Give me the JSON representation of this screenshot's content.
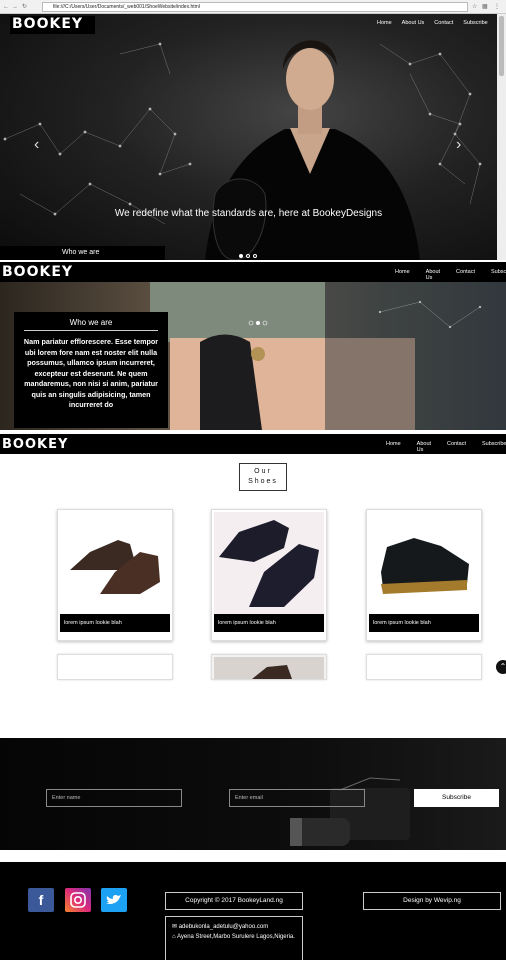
{
  "browser": {
    "url": "file:///C:/Users/User/Documents/_web001/ShoeWebsite/index.html",
    "back_icon": "back-arrow-icon",
    "forward_icon": "forward-arrow-icon",
    "reload_icon": "reload-icon"
  },
  "brand": {
    "logo_text": "BOOKEY"
  },
  "nav": {
    "items": [
      "Home",
      "About Us",
      "Contact",
      "Subscribe"
    ],
    "truncated_subscribe": "Subscr",
    "truncated_subscribe_2": "Subscrib"
  },
  "hero": {
    "caption": "We redefine what the standards are, here at BookeyDesigns",
    "left_arrow": "‹",
    "right_arrow": "›"
  },
  "who": {
    "title_peek": "Who we are",
    "title": "Who we are",
    "body": "Nam pariatur efflorescere. Esse tempor ubi lorem fore nam est noster elit nulla possumus, ullamco ipsum incurreret, excepteur est deserunt. Ne quem mandaremus, non nisi si anim, pariatur quis an singulis adipisicing, tamen incurreret do"
  },
  "shoes": {
    "title": "Our Shoes",
    "cards": [
      {
        "caption": "lorem ipsum lookie blah"
      },
      {
        "caption": "lorem ipsum lookie blah"
      },
      {
        "caption": "lorem ipsum lookie blah"
      }
    ]
  },
  "subscribe": {
    "name_placeholder": "Enter name",
    "email_placeholder": "Enter email",
    "button": "Subscribe"
  },
  "footer": {
    "copyright": "Copyright © 2017 BookeyLand.ng",
    "design": "Design by Wevip.ng",
    "email": "adebukonla_adetulu@yahoo.com",
    "address": "Ayena Street,Marbo Surulere Lagos,Nigeria."
  },
  "colors": {
    "facebook": "#3b5998",
    "twitter": "#1da1f2",
    "instagram_a": "#f58529",
    "instagram_b": "#8134af"
  }
}
